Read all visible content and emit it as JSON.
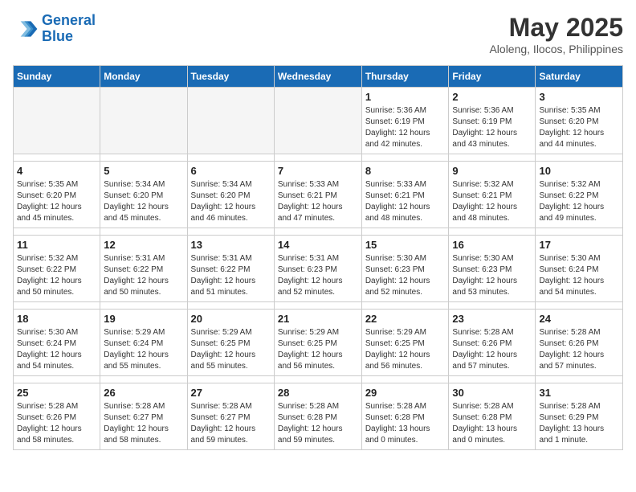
{
  "header": {
    "logo_line1": "General",
    "logo_line2": "Blue",
    "month_year": "May 2025",
    "location": "Aloleng, Ilocos, Philippines"
  },
  "weekdays": [
    "Sunday",
    "Monday",
    "Tuesday",
    "Wednesday",
    "Thursday",
    "Friday",
    "Saturday"
  ],
  "weeks": [
    [
      {
        "day": "",
        "info": ""
      },
      {
        "day": "",
        "info": ""
      },
      {
        "day": "",
        "info": ""
      },
      {
        "day": "",
        "info": ""
      },
      {
        "day": "1",
        "info": "Sunrise: 5:36 AM\nSunset: 6:19 PM\nDaylight: 12 hours\nand 42 minutes."
      },
      {
        "day": "2",
        "info": "Sunrise: 5:36 AM\nSunset: 6:19 PM\nDaylight: 12 hours\nand 43 minutes."
      },
      {
        "day": "3",
        "info": "Sunrise: 5:35 AM\nSunset: 6:20 PM\nDaylight: 12 hours\nand 44 minutes."
      }
    ],
    [
      {
        "day": "4",
        "info": "Sunrise: 5:35 AM\nSunset: 6:20 PM\nDaylight: 12 hours\nand 45 minutes."
      },
      {
        "day": "5",
        "info": "Sunrise: 5:34 AM\nSunset: 6:20 PM\nDaylight: 12 hours\nand 45 minutes."
      },
      {
        "day": "6",
        "info": "Sunrise: 5:34 AM\nSunset: 6:20 PM\nDaylight: 12 hours\nand 46 minutes."
      },
      {
        "day": "7",
        "info": "Sunrise: 5:33 AM\nSunset: 6:21 PM\nDaylight: 12 hours\nand 47 minutes."
      },
      {
        "day": "8",
        "info": "Sunrise: 5:33 AM\nSunset: 6:21 PM\nDaylight: 12 hours\nand 48 minutes."
      },
      {
        "day": "9",
        "info": "Sunrise: 5:32 AM\nSunset: 6:21 PM\nDaylight: 12 hours\nand 48 minutes."
      },
      {
        "day": "10",
        "info": "Sunrise: 5:32 AM\nSunset: 6:22 PM\nDaylight: 12 hours\nand 49 minutes."
      }
    ],
    [
      {
        "day": "11",
        "info": "Sunrise: 5:32 AM\nSunset: 6:22 PM\nDaylight: 12 hours\nand 50 minutes."
      },
      {
        "day": "12",
        "info": "Sunrise: 5:31 AM\nSunset: 6:22 PM\nDaylight: 12 hours\nand 50 minutes."
      },
      {
        "day": "13",
        "info": "Sunrise: 5:31 AM\nSunset: 6:22 PM\nDaylight: 12 hours\nand 51 minutes."
      },
      {
        "day": "14",
        "info": "Sunrise: 5:31 AM\nSunset: 6:23 PM\nDaylight: 12 hours\nand 52 minutes."
      },
      {
        "day": "15",
        "info": "Sunrise: 5:30 AM\nSunset: 6:23 PM\nDaylight: 12 hours\nand 52 minutes."
      },
      {
        "day": "16",
        "info": "Sunrise: 5:30 AM\nSunset: 6:23 PM\nDaylight: 12 hours\nand 53 minutes."
      },
      {
        "day": "17",
        "info": "Sunrise: 5:30 AM\nSunset: 6:24 PM\nDaylight: 12 hours\nand 54 minutes."
      }
    ],
    [
      {
        "day": "18",
        "info": "Sunrise: 5:30 AM\nSunset: 6:24 PM\nDaylight: 12 hours\nand 54 minutes."
      },
      {
        "day": "19",
        "info": "Sunrise: 5:29 AM\nSunset: 6:24 PM\nDaylight: 12 hours\nand 55 minutes."
      },
      {
        "day": "20",
        "info": "Sunrise: 5:29 AM\nSunset: 6:25 PM\nDaylight: 12 hours\nand 55 minutes."
      },
      {
        "day": "21",
        "info": "Sunrise: 5:29 AM\nSunset: 6:25 PM\nDaylight: 12 hours\nand 56 minutes."
      },
      {
        "day": "22",
        "info": "Sunrise: 5:29 AM\nSunset: 6:25 PM\nDaylight: 12 hours\nand 56 minutes."
      },
      {
        "day": "23",
        "info": "Sunrise: 5:28 AM\nSunset: 6:26 PM\nDaylight: 12 hours\nand 57 minutes."
      },
      {
        "day": "24",
        "info": "Sunrise: 5:28 AM\nSunset: 6:26 PM\nDaylight: 12 hours\nand 57 minutes."
      }
    ],
    [
      {
        "day": "25",
        "info": "Sunrise: 5:28 AM\nSunset: 6:26 PM\nDaylight: 12 hours\nand 58 minutes."
      },
      {
        "day": "26",
        "info": "Sunrise: 5:28 AM\nSunset: 6:27 PM\nDaylight: 12 hours\nand 58 minutes."
      },
      {
        "day": "27",
        "info": "Sunrise: 5:28 AM\nSunset: 6:27 PM\nDaylight: 12 hours\nand 59 minutes."
      },
      {
        "day": "28",
        "info": "Sunrise: 5:28 AM\nSunset: 6:28 PM\nDaylight: 12 hours\nand 59 minutes."
      },
      {
        "day": "29",
        "info": "Sunrise: 5:28 AM\nSunset: 6:28 PM\nDaylight: 13 hours\nand 0 minutes."
      },
      {
        "day": "30",
        "info": "Sunrise: 5:28 AM\nSunset: 6:28 PM\nDaylight: 13 hours\nand 0 minutes."
      },
      {
        "day": "31",
        "info": "Sunrise: 5:28 AM\nSunset: 6:29 PM\nDaylight: 13 hours\nand 1 minute."
      }
    ]
  ]
}
